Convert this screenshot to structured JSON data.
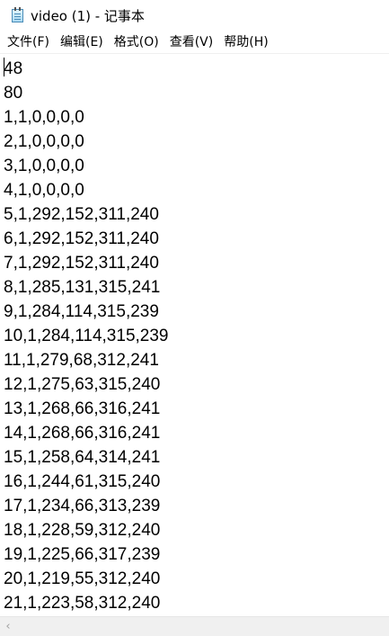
{
  "window": {
    "title": "video (1) - 记事本"
  },
  "menu": [
    {
      "label": "文件(F)"
    },
    {
      "label": "编辑(E)"
    },
    {
      "label": "格式(O)"
    },
    {
      "label": "查看(V)"
    },
    {
      "label": "帮助(H)"
    }
  ],
  "editor": {
    "lines": [
      "48",
      "80",
      "1,1,0,0,0,0",
      "2,1,0,0,0,0",
      "3,1,0,0,0,0",
      "4,1,0,0,0,0",
      "5,1,292,152,311,240",
      "6,1,292,152,311,240",
      "7,1,292,152,311,240",
      "8,1,285,131,315,241",
      "9,1,284,114,315,239",
      "10,1,284,114,315,239",
      "11,1,279,68,312,241",
      "12,1,275,63,315,240",
      "13,1,268,66,316,241",
      "14,1,268,66,316,241",
      "15,1,258,64,314,241",
      "16,1,244,61,315,240",
      "17,1,234,66,313,239",
      "18,1,228,59,312,240",
      "19,1,225,66,317,239",
      "20,1,219,55,312,240",
      "21,1,223,58,312,240"
    ]
  },
  "scrollbar": {
    "left_arrow_icon": "chevron-left-icon"
  }
}
